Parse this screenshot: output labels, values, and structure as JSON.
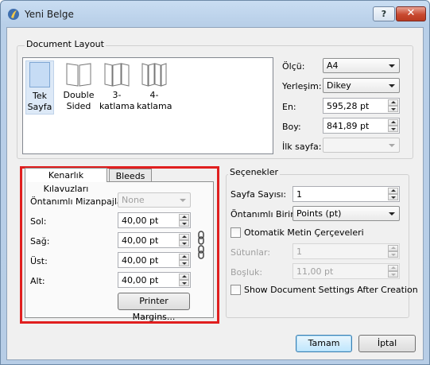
{
  "window": {
    "title": "Yeni Belge",
    "help_label": "?",
    "close_label": "✕"
  },
  "document_layout": {
    "group_label": "Document Layout",
    "items": [
      {
        "line1": "Tek",
        "line2": "Sayfa"
      },
      {
        "line1": "Double",
        "line2": "Sided"
      },
      {
        "line1": "3-",
        "line2": "katlama"
      },
      {
        "line1": "4-",
        "line2": "katlama"
      }
    ],
    "size_label": "Ölçü:",
    "size_value": "A4",
    "orientation_label": "Yerleşim:",
    "orientation_value": "Dikey",
    "width_label": "En:",
    "width_value": "595,28 pt",
    "height_label": "Boy:",
    "height_value": "841,89 pt",
    "first_page_label": "İlk sayfa:",
    "first_page_value": ""
  },
  "margins": {
    "tab_margin_guides": "Kenarlık Kılavuzları",
    "tab_bleeds": "Bleeds",
    "preset_label": "Öntanımlı Mizanpajlar:",
    "preset_value": "None",
    "left_label": "Sol:",
    "left_value": "40,00 pt",
    "right_label": "Sağ:",
    "right_value": "40,00 pt",
    "top_label": "Üst:",
    "top_value": "40,00 pt",
    "bottom_label": "Alt:",
    "bottom_value": "40,00 pt",
    "printer_margins_button": "Printer Margins..."
  },
  "options": {
    "group_label": "Seçenekler",
    "page_count_label": "Sayfa Sayısı:",
    "page_count_value": "1",
    "default_unit_label": "Öntanımlı Birim:",
    "default_unit_value": "Points (pt)",
    "auto_frames_label": "Otomatik Metin Çerçeveleri",
    "columns_label": "Sütunlar:",
    "columns_value": "1",
    "gap_label": "Boşluk:",
    "gap_value": "11,00 pt",
    "show_settings_label": "Show Document Settings After Creation"
  },
  "buttons": {
    "ok": "Tamam",
    "cancel": "İptal"
  }
}
